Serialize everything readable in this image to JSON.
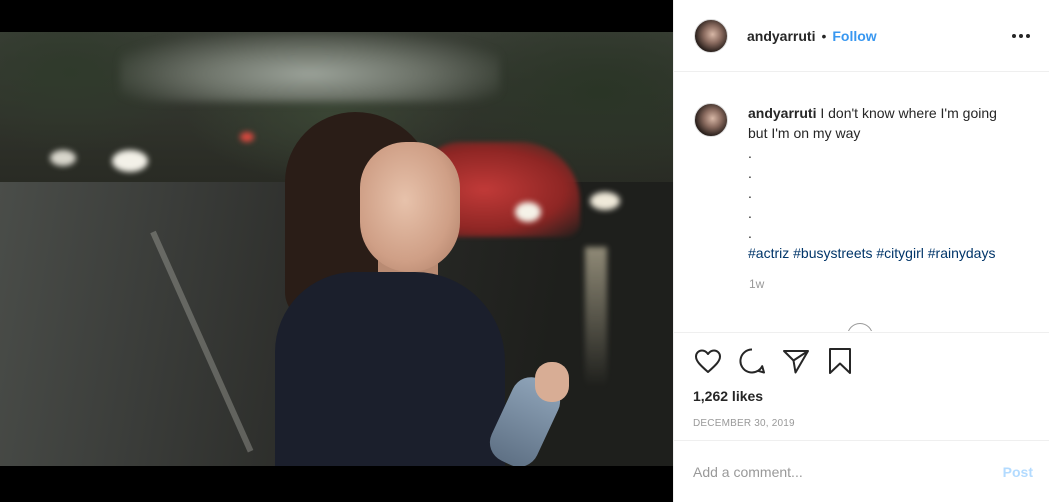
{
  "post": {
    "author": {
      "username": "andyarruti",
      "separator": "•",
      "follow_label": "Follow"
    },
    "caption": {
      "username": "andyarruti",
      "text": "I don't know where I'm going but I'm on my way",
      "dots": [
        ".",
        ".",
        ".",
        ".",
        "."
      ],
      "hashtags": [
        "#actriz",
        "#busystreets",
        "#citygirl",
        "#rainydays"
      ],
      "time_ago": "1w"
    },
    "likes": "1,262 likes",
    "date": "DECEMBER 30, 2019",
    "comment": {
      "placeholder": "Add a comment...",
      "post_label": "Post"
    },
    "icons": {
      "more": "more-options-icon",
      "like": "heart-icon",
      "comment": "comment-bubble-icon",
      "share": "paper-plane-icon",
      "save": "bookmark-icon"
    },
    "colors": {
      "link": "#3897f0",
      "hashtag": "#003569",
      "muted": "#999999",
      "post_disabled": "#b3dbff"
    }
  }
}
